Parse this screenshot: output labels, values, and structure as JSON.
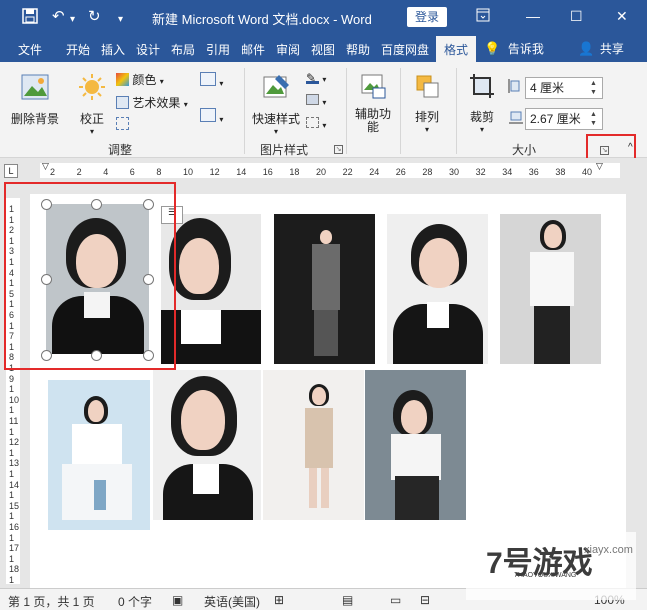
{
  "titlebar": {
    "save_icon": "save-icon",
    "undo_icon": "undo-icon",
    "redo_icon": "redo-icon",
    "customize_icon": "chevron-down-icon",
    "title": "新建 Microsoft Word 文档.docx  -  Word",
    "login": "登录",
    "ribbon_display_icon": "ribbon-display-icon",
    "minimize": "—",
    "maximize": "☐",
    "close": "✕"
  },
  "tabs": {
    "file": "文件",
    "home": "开始",
    "insert": "插入",
    "design": "设计",
    "layout": "布局",
    "references": "引用",
    "mailings": "邮件",
    "review": "审阅",
    "view": "视图",
    "help": "帮助",
    "baidu": "百度网盘",
    "format": "格式",
    "tellme": "告诉我",
    "share": "共享"
  },
  "ribbon": {
    "remove_bg": "删除背景",
    "corrections": "校正",
    "color": "颜色",
    "artistic": "艺术效果",
    "group_adjust": "调整",
    "quick_styles": "快速样式",
    "group_picture_styles": "图片样式",
    "accessibility": "辅助功\n能",
    "accessibility_l1": "辅助功",
    "accessibility_l2": "能",
    "arrange": "排列",
    "crop": "裁剪",
    "height_value": "4 厘米",
    "width_value": "2.67 厘米",
    "group_size": "大小"
  },
  "ruler": {
    "h_numbers": [
      "2",
      "2",
      "4",
      "6",
      "8",
      "10",
      "12",
      "14",
      "16",
      "18",
      "20",
      "22",
      "24",
      "26",
      "28",
      "30",
      "32",
      "34",
      "36",
      "38",
      "40"
    ],
    "v_numbers": [
      "1",
      "1",
      "2",
      "1",
      "3",
      "1",
      "4",
      "1",
      "5",
      "1",
      "6",
      "1",
      "7",
      "1",
      "8",
      "1",
      "9",
      "1",
      "10",
      "1",
      "11",
      "1",
      "12",
      "1",
      "13",
      "1",
      "14",
      "1",
      "15",
      "1",
      "16",
      "1",
      "17",
      "1",
      "18",
      "1"
    ]
  },
  "status": {
    "page": "第 1 页，共 1 页",
    "words": "0 个字",
    "lang": "英语(美国)",
    "zoom": "100%"
  },
  "watermark": {
    "brand": "7号游戏",
    "sub": "7HAOYOUXIWANG",
    "url": "xiayx.com"
  },
  "colors": {
    "accent": "#2b579a",
    "highlight": "#e32a2a"
  }
}
